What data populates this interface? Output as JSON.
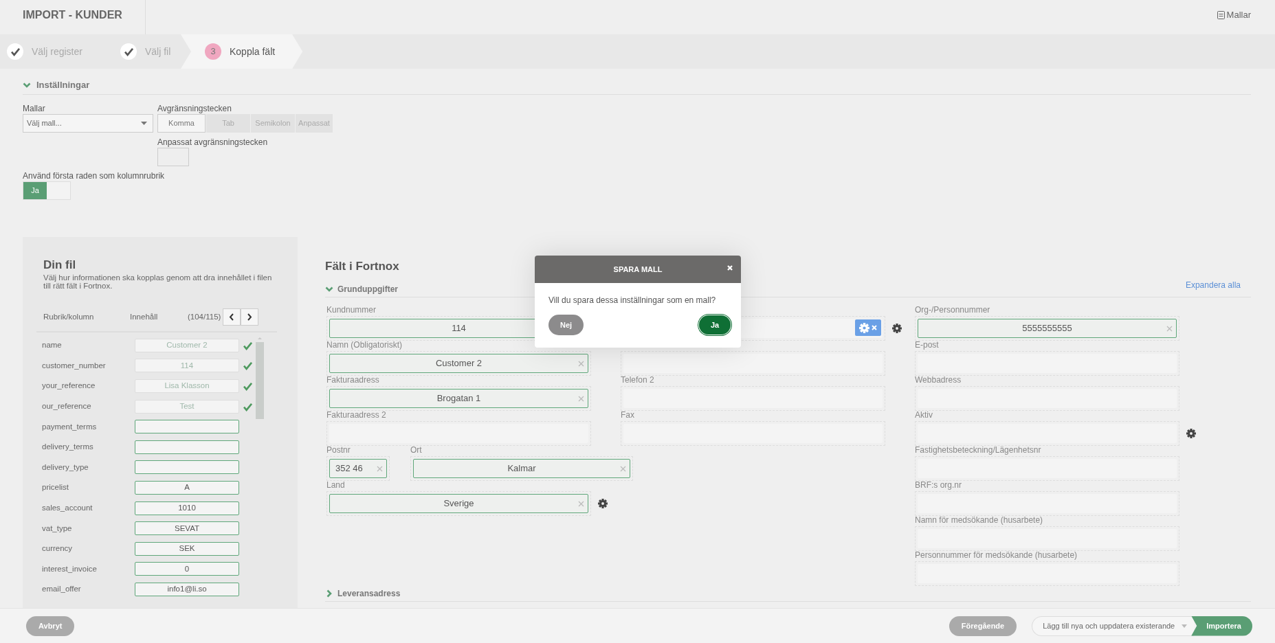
{
  "header": {
    "title": "IMPORT - KUNDER",
    "templates_link": "Mallar"
  },
  "steps": [
    {
      "label": "Välj register",
      "done": true,
      "selected": false
    },
    {
      "label": "Välj fil",
      "done": true,
      "selected": false
    },
    {
      "number": "3",
      "label": "Koppla fält",
      "done": false,
      "selected": true
    }
  ],
  "settings": {
    "title": "Inställningar",
    "expanded": true,
    "template": {
      "label": "Mallar",
      "placeholder": "Välj mall..."
    },
    "delimiter": {
      "label": "Avgränsningstecken",
      "options": [
        {
          "label": "Komma",
          "selected": true
        },
        {
          "label": "Tab",
          "selected": false
        },
        {
          "label": "Semikolon",
          "selected": false
        },
        {
          "label": "Anpassat",
          "selected": false
        }
      ]
    },
    "custom_delimiter": {
      "label": "Anpassat avgränsningstecken"
    },
    "header_row": {
      "label": "Använd första raden som kolumnrubrik",
      "on_label": "Ja",
      "on": true
    }
  },
  "file_panel": {
    "title": "Din fil",
    "description": "Välj hur informationen ska kopplas genom att dra innehållet i filen till rätt fält i Fortnox.",
    "columns": [
      "Rubrik/kolumn",
      "Innehåll"
    ],
    "counter": "(104/115)",
    "rows": [
      {
        "name": "name",
        "value": "Customer 2",
        "mapped": true
      },
      {
        "name": "customer_number",
        "value": "114",
        "mapped": true
      },
      {
        "name": "your_reference",
        "value": "Lisa Klasson",
        "mapped": true
      },
      {
        "name": "our_reference",
        "value": "Test",
        "mapped": true
      },
      {
        "name": "payment_terms",
        "mapped": false
      },
      {
        "name": "delivery_terms",
        "mapped": false
      },
      {
        "name": "delivery_type",
        "mapped": false
      },
      {
        "name": "pricelist",
        "value": "A",
        "mapped": false
      },
      {
        "name": "sales_account",
        "value": "1010",
        "mapped": false
      },
      {
        "name": "vat_type",
        "value": "SEVAT",
        "mapped": false
      },
      {
        "name": "currency",
        "value": "SEK",
        "mapped": false
      },
      {
        "name": "interest_invoice",
        "value": "0",
        "mapped": false
      },
      {
        "name": "email_offer",
        "value": "info1@li.so",
        "mapped": false
      }
    ]
  },
  "fields_panel": {
    "title": "Fält i Fortnox",
    "expand_all": "Expandera alla",
    "sections": [
      {
        "title": "Grunduppgifter",
        "expanded": true,
        "columns": [
          [
            {
              "label": "Kundnummer",
              "value": "114"
            },
            {
              "label": "Namn (Obligatoriskt)",
              "value": "Customer 2",
              "clearable": true
            },
            {
              "label": "Fakturaadress",
              "value": "Brogatan 1",
              "clearable": true
            },
            {
              "label": "Fakturaadress 2"
            },
            {
              "kind": "pair",
              "fields": [
                {
                  "label": "Postnr",
                  "value": "352 46",
                  "clearable": true
                },
                {
                  "label": "Ort",
                  "value": "Kalmar",
                  "clearable": true
                }
              ]
            },
            {
              "label": "Land",
              "value": "Sverige",
              "settings": true,
              "clearable": true
            }
          ],
          [
            {
              "link_chip": true,
              "settings": true
            },
            {},
            {
              "label": "Telefon 2"
            },
            {
              "label": "Fax"
            }
          ],
          [
            {
              "label": "Org-/Personnummer",
              "value": "5555555555",
              "clearable": true
            },
            {
              "label": "E-post"
            },
            {
              "label": "Webbadress"
            },
            {
              "label": "Aktiv",
              "settings": true
            },
            {
              "label": "Fastighetsbeteckning/Lägenhetsnr"
            },
            {
              "label": "BRF:s org.nr"
            },
            {
              "label": "Namn för medsökande (husarbete)"
            },
            {
              "label": "Personnummer för medsökande (husarbete)"
            }
          ]
        ]
      },
      {
        "title": "Leveransadress",
        "expanded": false
      }
    ]
  },
  "modal": {
    "title": "SPARA MALL",
    "message": "Vill du spara dessa inställningar som en mall?",
    "buttons": [
      {
        "label": "Nej",
        "kind": "secondary"
      },
      {
        "label": "Ja",
        "kind": "primary"
      }
    ]
  },
  "footer": {
    "cancel": "Avbryt",
    "previous": "Föregående",
    "mode": "Lägg till nya och uppdatera existerande",
    "import": "Importera"
  }
}
